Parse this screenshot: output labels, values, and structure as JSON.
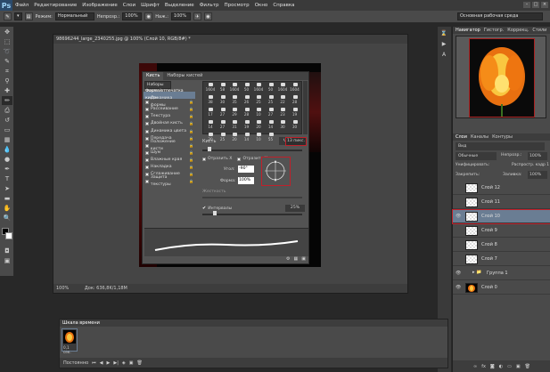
{
  "app": {
    "logo": "Ps"
  },
  "menu": [
    "Файл",
    "Редактирование",
    "Изображение",
    "Слои",
    "Шрифт",
    "Выделение",
    "Фильтр",
    "Просмотр",
    "Окно",
    "Справка"
  ],
  "options": {
    "mode_label": "Режим:",
    "mode_value": "Нормальный",
    "opacity_label": "Непрозр.:",
    "opacity_value": "100%",
    "flow_label": "Наж.:",
    "flow_value": "100%",
    "workspace": "Основная рабочая среда"
  },
  "document": {
    "title": "98696244_large_2340255.jpg @ 100% (Слой 10, RGB/8#) *",
    "zoom": "100%",
    "doc_size": "Док: 636,8K/1,18M"
  },
  "brush_panel": {
    "tabs": [
      "Кисть",
      "Наборы кистей"
    ],
    "active_tab": "Кисть",
    "items": [
      {
        "label": "Форма отпечатка кисти",
        "checkbox": false,
        "selected": true
      },
      {
        "label": "Динамика формы",
        "checkbox": true,
        "selected": false
      },
      {
        "label": "Рассеивание",
        "checkbox": true,
        "selected": false
      },
      {
        "label": "Текстура",
        "checkbox": true,
        "selected": false
      },
      {
        "label": "Двойная кисть",
        "checkbox": true,
        "selected": false
      },
      {
        "label": "Динамика цвета",
        "checkbox": true,
        "selected": false
      },
      {
        "label": "Передача",
        "checkbox": true,
        "selected": false
      },
      {
        "label": "Положение кисти",
        "checkbox": true,
        "selected": false
      },
      {
        "label": "Шум",
        "checkbox": true,
        "selected": false
      },
      {
        "label": "Влажные края",
        "checkbox": true,
        "selected": false
      },
      {
        "label": "Накладка",
        "checkbox": true,
        "selected": false
      },
      {
        "label": "Сглаживание",
        "checkbox": true,
        "selected": false
      },
      {
        "label": "Защита текстуры",
        "checkbox": true,
        "selected": false
      }
    ],
    "tip_sizes": [
      "1604",
      "58",
      "1604",
      "50",
      "1604",
      "50",
      "1604",
      "1604",
      "38",
      "30",
      "35",
      "26",
      "25",
      "25",
      "22",
      "28",
      "17",
      "27",
      "29",
      "28",
      "10",
      "27",
      "23",
      "19",
      "14",
      "27",
      "31",
      "19",
      "20",
      "14",
      "30",
      "30",
      "20",
      "25",
      "20",
      "14",
      "10",
      "55"
    ],
    "size_label": "Кисть",
    "size_value": "13 пикс.",
    "flip_x": "Отразить X",
    "flip_y": "Отразить Y",
    "angle_label": "Угол:",
    "angle_value": "-90°",
    "roundness_label": "Форма:",
    "roundness_value": "100%",
    "hardness_label": "Жесткость",
    "spacing_label": "Интервалы",
    "spacing_value": "25%"
  },
  "navigator": {
    "tabs": [
      "Навигатор",
      "Гистогр.",
      "Коррекц.",
      "Стили"
    ]
  },
  "layers_panel": {
    "tabs": [
      "Слои",
      "Каналы",
      "Контуры"
    ],
    "kind": "Вид",
    "blend": "Обычные",
    "opacity_label": "Непрозр.:",
    "opacity_value": "100%",
    "lock_label": "Закрепить:",
    "fill_label": "Заливка:",
    "fill_value": "100%",
    "unify_label": "Унифицировать:",
    "propagate_label": "Распростр. кадр 1",
    "layers": [
      "Слой 12",
      "Слой 11",
      "Слой 10",
      "Слой 9",
      "Слой 8",
      "Слой 7",
      "Группа 1",
      "Слой 0"
    ]
  },
  "timeline": {
    "title": "Шкала времени",
    "frame_delay": "0,1 сек.",
    "loop": "Постоянно"
  }
}
